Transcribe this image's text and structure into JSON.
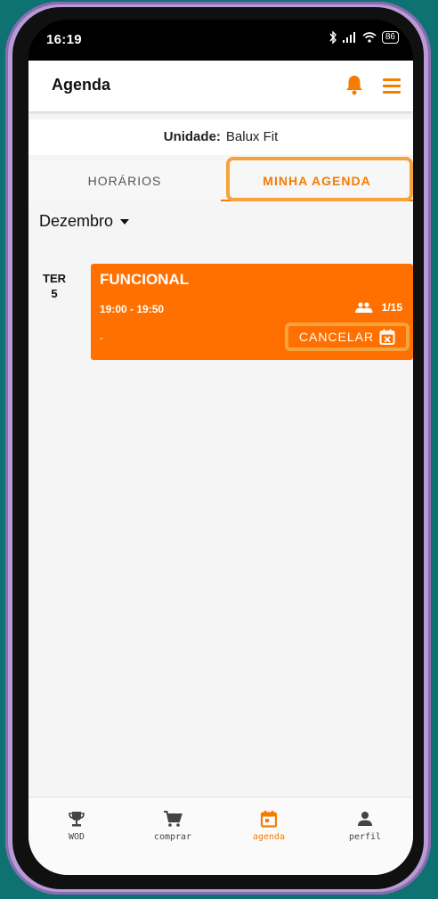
{
  "status_bar": {
    "time": "16:19",
    "battery": "86"
  },
  "header": {
    "title": "Agenda"
  },
  "unit": {
    "label": "Unidade:",
    "value": "Balux Fit"
  },
  "tabs": [
    {
      "label": "HORÁRIOS",
      "active": false
    },
    {
      "label": "MINHA AGENDA",
      "active": true
    }
  ],
  "month_selector": {
    "value": "Dezembro"
  },
  "schedule": {
    "day_name": "TER",
    "day_number": "5",
    "class": {
      "name": "FUNCIONAL",
      "time": "19:00 - 19:50",
      "capacity": "1/15",
      "note": "-",
      "cancel_label": "CANCELAR"
    }
  },
  "bottom_nav": [
    {
      "label": "WOD",
      "icon": "trophy-icon",
      "active": false
    },
    {
      "label": "comprar",
      "icon": "cart-icon",
      "active": false
    },
    {
      "label": "agenda",
      "icon": "calendar-icon",
      "active": true
    },
    {
      "label": "perfil",
      "icon": "person-icon",
      "active": false
    }
  ],
  "colors": {
    "accent": "#f57c00",
    "card": "#ff7000",
    "highlight": "#f5a33c",
    "background": "#0e7272"
  }
}
